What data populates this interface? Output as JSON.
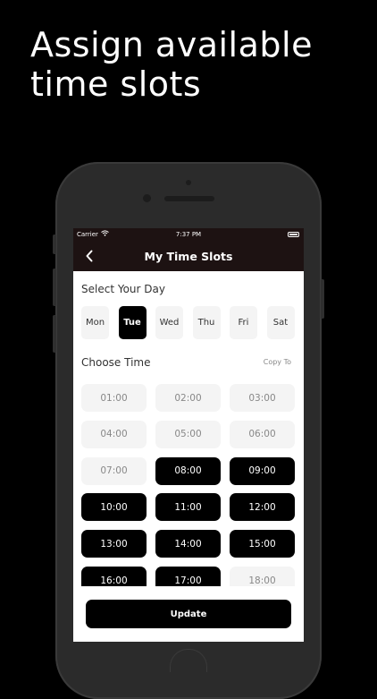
{
  "headline": {
    "line1": "Assign available",
    "line2": "time slots"
  },
  "status_bar": {
    "carrier": "Carrier",
    "time": "7:37 PM"
  },
  "nav": {
    "title": "My Time Slots",
    "back_icon": "chevron-left-icon"
  },
  "day_section": {
    "title": "Select Your Day",
    "days": [
      {
        "label": "Mon",
        "selected": false
      },
      {
        "label": "Tue",
        "selected": true
      },
      {
        "label": "Wed",
        "selected": false
      },
      {
        "label": "Thu",
        "selected": false
      },
      {
        "label": "Fri",
        "selected": false
      },
      {
        "label": "Sat",
        "selected": false
      }
    ]
  },
  "time_section": {
    "title": "Choose Time",
    "copy_to": "Copy To",
    "slots": [
      {
        "label": "01:00",
        "selected": false
      },
      {
        "label": "02:00",
        "selected": false
      },
      {
        "label": "03:00",
        "selected": false
      },
      {
        "label": "04:00",
        "selected": false
      },
      {
        "label": "05:00",
        "selected": false
      },
      {
        "label": "06:00",
        "selected": false
      },
      {
        "label": "07:00",
        "selected": false
      },
      {
        "label": "08:00",
        "selected": true
      },
      {
        "label": "09:00",
        "selected": true
      },
      {
        "label": "10:00",
        "selected": true
      },
      {
        "label": "11:00",
        "selected": true
      },
      {
        "label": "12:00",
        "selected": true
      },
      {
        "label": "13:00",
        "selected": true
      },
      {
        "label": "14:00",
        "selected": true
      },
      {
        "label": "15:00",
        "selected": true
      },
      {
        "label": "16:00",
        "selected": true
      },
      {
        "label": "17:00",
        "selected": true
      },
      {
        "label": "18:00",
        "selected": false
      }
    ]
  },
  "footer": {
    "update_label": "Update"
  },
  "colors": {
    "accent": "#000000",
    "navbar": "#1d1212",
    "unselected": "#f4f4f4"
  }
}
